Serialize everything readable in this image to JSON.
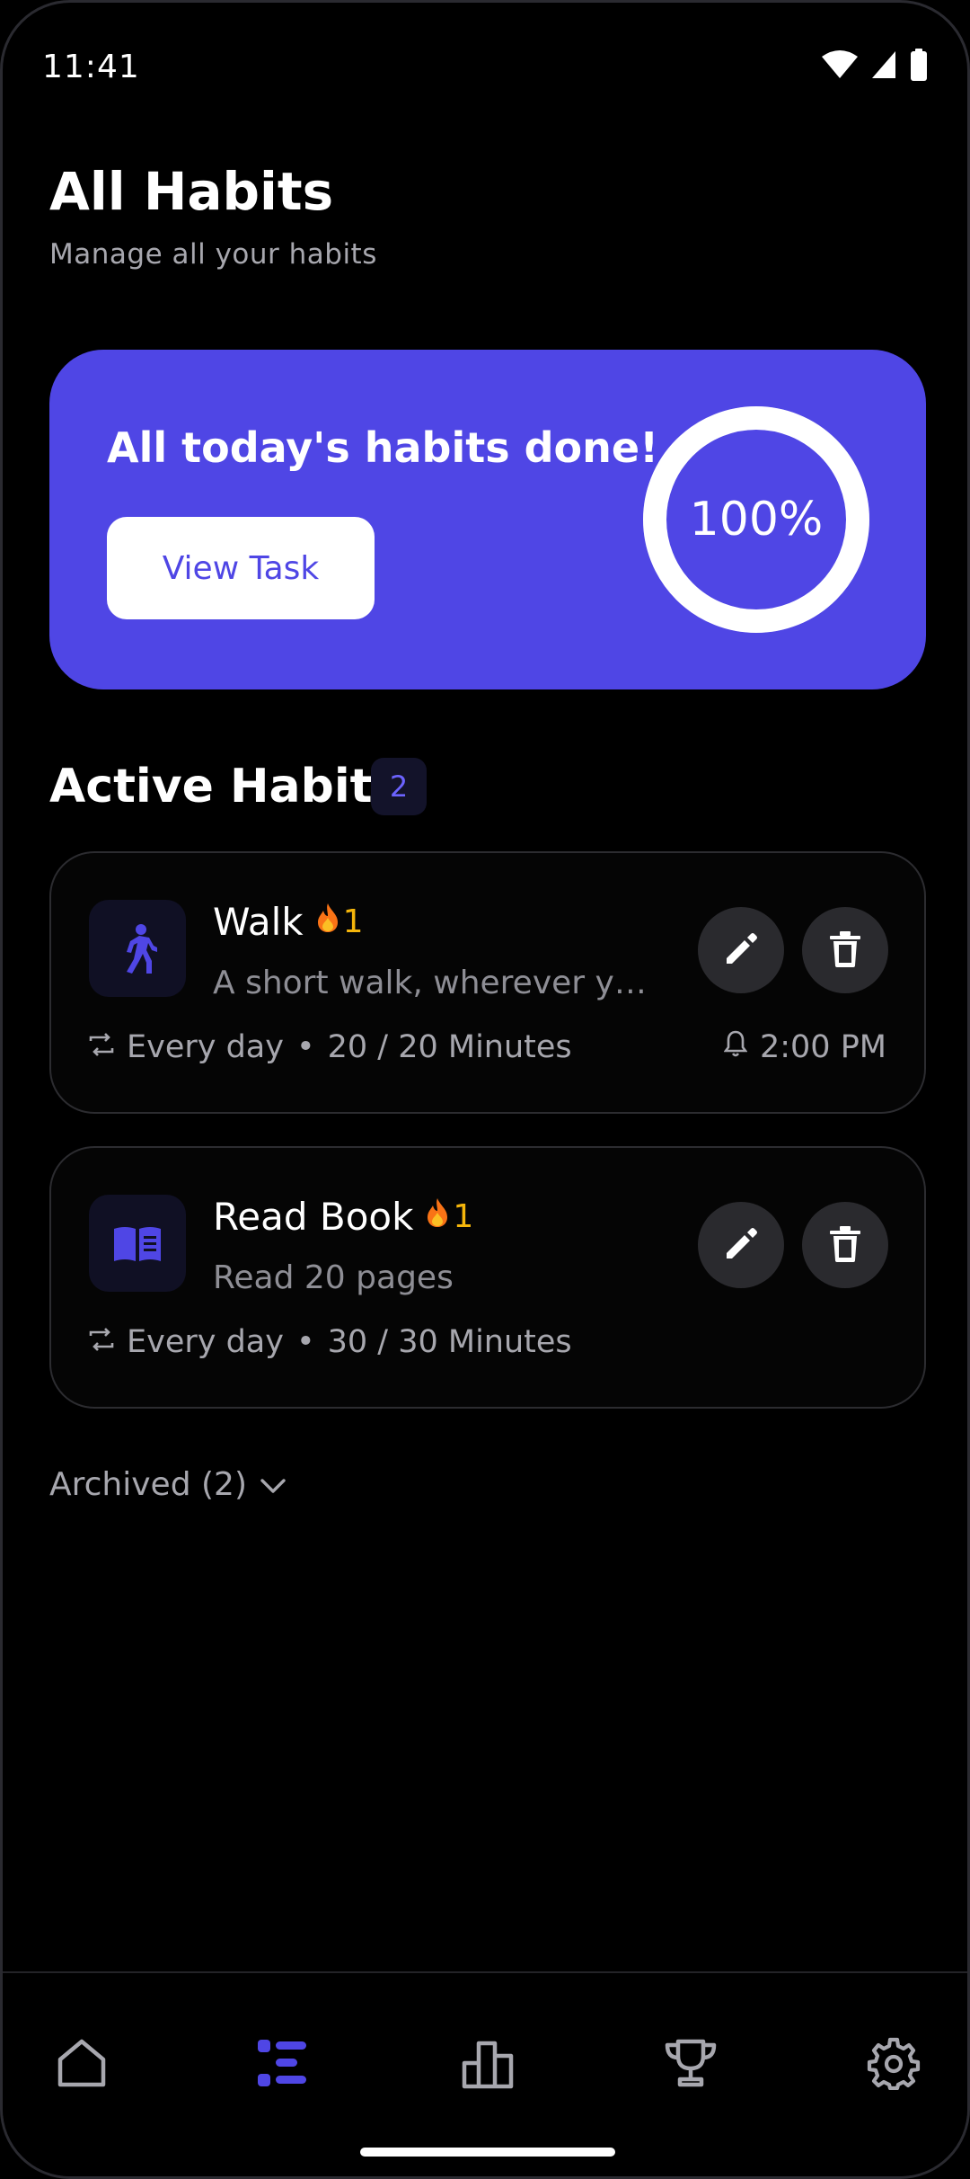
{
  "status_bar": {
    "time": "11:41"
  },
  "header": {
    "title": "All Habits",
    "subtitle": "Manage all your habits"
  },
  "progress_card": {
    "message": "All today's habits done!",
    "button_label": "View Task",
    "percent_label": "100%",
    "progress": 1.0,
    "color": "#4f46e5"
  },
  "active_section": {
    "title": "Active Habits",
    "count": "2"
  },
  "habits": [
    {
      "name": "Walk",
      "icon": "walk-icon",
      "streak": "1",
      "description": "A short walk, wherever you are.",
      "frequency": "Every day",
      "goal": "20 / 20 Minutes",
      "reminder": "2:00 PM"
    },
    {
      "name": "Read Book",
      "icon": "book-icon",
      "streak": "1",
      "description": "Read 20 pages",
      "frequency": "Every day",
      "goal": "30 / 30 Minutes",
      "reminder": ""
    }
  ],
  "archived": {
    "label": "Archived (2)"
  },
  "bottom_nav": {
    "items": [
      "home-icon",
      "habits-list-icon",
      "stats-icon",
      "trophy-icon",
      "settings-icon"
    ],
    "active_index": 1,
    "active_color": "#4f46e5",
    "inactive_color": "#a7a7ae"
  },
  "colors": {
    "accent": "#4f46e5",
    "streak": "#f5b60b",
    "background": "#000000"
  }
}
